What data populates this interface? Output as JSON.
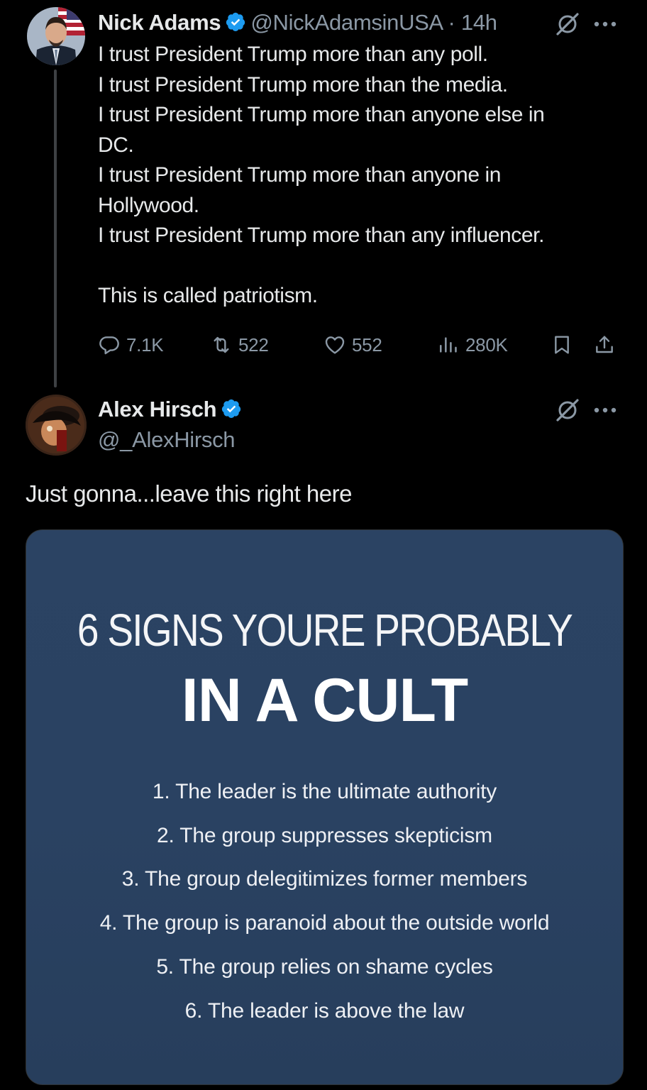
{
  "tweet1": {
    "author_name": "Nick Adams",
    "handle": "@NickAdamsinUSA",
    "separator": "·",
    "time": "14h",
    "lines": [
      "I trust President Trump more than any poll.",
      "I trust President Trump more than the media.",
      "I trust President Trump more than anyone else in",
      "DC.",
      "I trust President Trump more than anyone in",
      "Hollywood.",
      "I trust President Trump more than any influencer."
    ],
    "closing_line": "This is called patriotism.",
    "stats": {
      "replies": "7.1K",
      "retweets": "522",
      "likes": "552",
      "views": "280K"
    },
    "icons": [
      "verified-badge-icon",
      "grok-icon",
      "more-icon",
      "reply-icon",
      "retweet-icon",
      "like-icon",
      "views-icon",
      "bookmark-icon",
      "share-icon"
    ]
  },
  "tweet2": {
    "author_name": "Alex Hirsch",
    "handle": "@_AlexHirsch",
    "text": "Just gonna...leave this right here",
    "image": {
      "heading_line1": "6 SIGNS YOURE PROBABLY",
      "heading_line2": "IN A CULT",
      "items": [
        "1. The leader is the ultimate authority",
        "2. The group suppresses skepticism",
        "3. The group delegitimizes former members",
        "4. The group is paranoid about the outside world",
        "5. The group relies on shame cycles",
        "6. The leader is above the law"
      ]
    }
  },
  "colors": {
    "background": "#000000",
    "text": "#e7e9ea",
    "secondary": "#8b98a5",
    "verified": "#1d9bf0",
    "card": "#2a4262"
  }
}
